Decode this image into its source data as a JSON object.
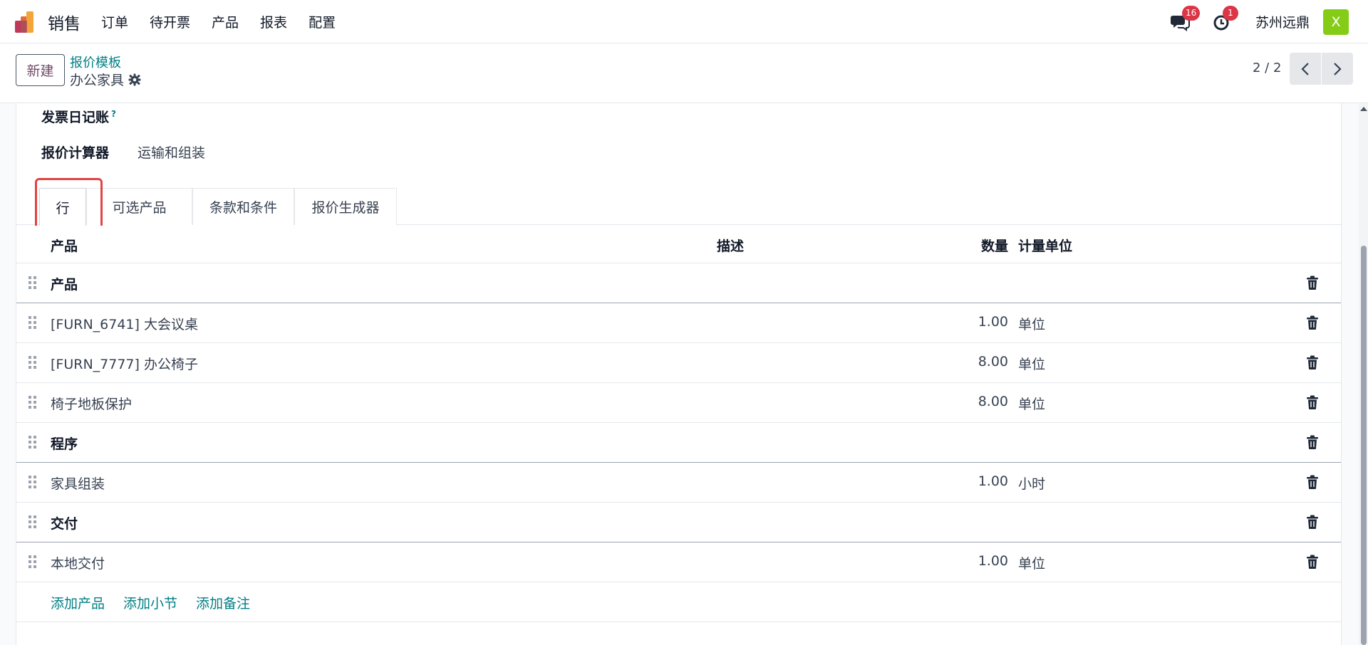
{
  "navbar": {
    "app_name": "销售",
    "menu": [
      "订单",
      "待开票",
      "产品",
      "报表",
      "配置"
    ],
    "messages_badge": "16",
    "activities_badge": "1",
    "company": "苏州远鼎",
    "avatar_letter": "X"
  },
  "control_panel": {
    "new_label": "新建",
    "breadcrumb": "报价模板",
    "record_title": "办公家具",
    "pager": "2 / 2"
  },
  "form": {
    "journal_label": "发票日记账",
    "journal_help": "?",
    "section_tabs": [
      "报价计算器",
      "运输和组装"
    ],
    "notebook_tabs": [
      "行",
      "可选产品",
      "条款和条件",
      "报价生成器"
    ],
    "columns": {
      "product": "产品",
      "description": "描述",
      "quantity": "数量",
      "uom": "计量单位"
    },
    "lines": [
      {
        "type": "section",
        "name": "产品",
        "qty": "",
        "uom": ""
      },
      {
        "type": "line",
        "name": "[FURN_6741] 大会议桌",
        "qty": "1.00",
        "uom": "单位"
      },
      {
        "type": "line",
        "name": "[FURN_7777] 办公椅子",
        "qty": "8.00",
        "uom": "单位"
      },
      {
        "type": "line",
        "name": "椅子地板保护",
        "qty": "8.00",
        "uom": "单位"
      },
      {
        "type": "section",
        "name": "程序",
        "qty": "",
        "uom": ""
      },
      {
        "type": "line",
        "name": "家具组装",
        "qty": "1.00",
        "uom": "小时"
      },
      {
        "type": "section",
        "name": "交付",
        "qty": "",
        "uom": ""
      },
      {
        "type": "line",
        "name": "本地交付",
        "qty": "1.00",
        "uom": "单位"
      }
    ],
    "add_links": [
      "添加产品",
      "添加小节",
      "添加备注"
    ]
  },
  "colors": {
    "accent": "#017e84",
    "brand": "#714b67",
    "badge": "#dc3545",
    "highlight": "#e24343"
  }
}
